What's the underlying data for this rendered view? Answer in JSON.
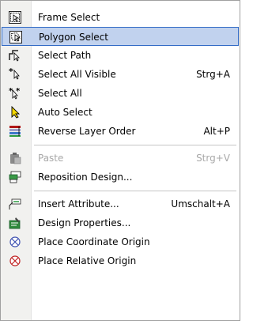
{
  "menu": {
    "items": [
      {
        "label": "Frame Select",
        "shortcut": "",
        "icon": "frame-select-icon"
      },
      {
        "label": "Polygon Select",
        "shortcut": "",
        "icon": "polygon-select-icon",
        "selected": true
      },
      {
        "label": "Select Path",
        "shortcut": "",
        "icon": "select-path-icon"
      },
      {
        "label": "Select All Visible",
        "shortcut": "Strg+A",
        "icon": "select-all-visible-icon"
      },
      {
        "label": "Select All",
        "shortcut": "",
        "icon": "select-all-icon"
      },
      {
        "label": "Auto Select",
        "shortcut": "",
        "icon": "auto-select-icon"
      },
      {
        "label": "Reverse Layer Order",
        "shortcut": "Alt+P",
        "icon": "reverse-layer-order-icon"
      },
      {
        "label": "Paste",
        "shortcut": "Strg+V",
        "icon": "paste-icon",
        "disabled": true
      },
      {
        "label": "Reposition Design...",
        "shortcut": "",
        "icon": "reposition-design-icon"
      },
      {
        "label": "Insert Attribute...",
        "shortcut": "Umschalt+A",
        "icon": "insert-attribute-icon"
      },
      {
        "label": "Design Properties...",
        "shortcut": "",
        "icon": "design-properties-icon"
      },
      {
        "label": "Place Coordinate Origin",
        "shortcut": "",
        "icon": "place-coordinate-origin-icon"
      },
      {
        "label": "Place Relative Origin",
        "shortcut": "",
        "icon": "place-relative-origin-icon"
      }
    ]
  },
  "colors": {
    "highlight_bg": "#c1d2ee",
    "highlight_border": "#316ac5",
    "gutter": "#f1f1ef",
    "disabled_text": "#a8a8a8"
  }
}
